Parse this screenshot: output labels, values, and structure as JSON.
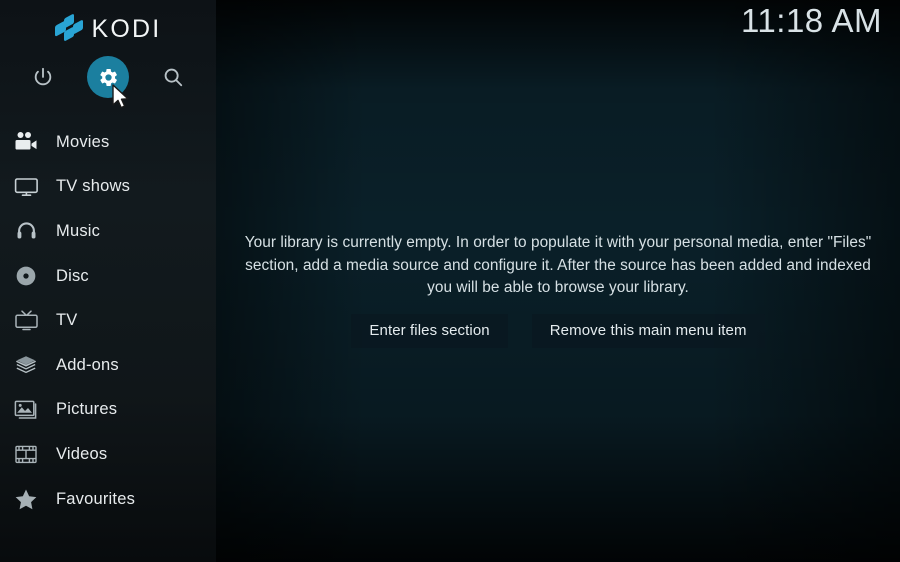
{
  "app": {
    "name": "KODI",
    "logo_color": "#29a4d4",
    "accent_color": "#1b7f9f",
    "sidebar_bg": "#101619",
    "panel_bg": "#124a60"
  },
  "clock": {
    "time": "11:18 AM"
  },
  "toolbar": {
    "items": [
      {
        "icon": "power-icon",
        "label": "Power",
        "active": false
      },
      {
        "icon": "gear-icon",
        "label": "Settings",
        "active": true
      },
      {
        "icon": "search-icon",
        "label": "Search",
        "active": false
      }
    ]
  },
  "sidebar": {
    "items": [
      {
        "label": "Movies",
        "icon": "movie-camera-icon"
      },
      {
        "label": "TV shows",
        "icon": "monitor-icon"
      },
      {
        "label": "Music",
        "icon": "headphones-icon"
      },
      {
        "label": "Disc",
        "icon": "disc-icon"
      },
      {
        "label": "TV",
        "icon": "television-icon"
      },
      {
        "label": "Add-ons",
        "icon": "open-box-icon"
      },
      {
        "label": "Pictures",
        "icon": "picture-frame-icon"
      },
      {
        "label": "Videos",
        "icon": "film-strip-icon"
      },
      {
        "label": "Favourites",
        "icon": "star-icon"
      }
    ]
  },
  "main": {
    "empty_message": "Your library is currently empty. In order to populate it with your personal media, enter \"Files\" section, add a media source and configure it. After the source has been added and indexed you will be able to browse your library.",
    "buttons": {
      "enter_files": "Enter files section",
      "remove_item": "Remove this main menu item"
    }
  }
}
